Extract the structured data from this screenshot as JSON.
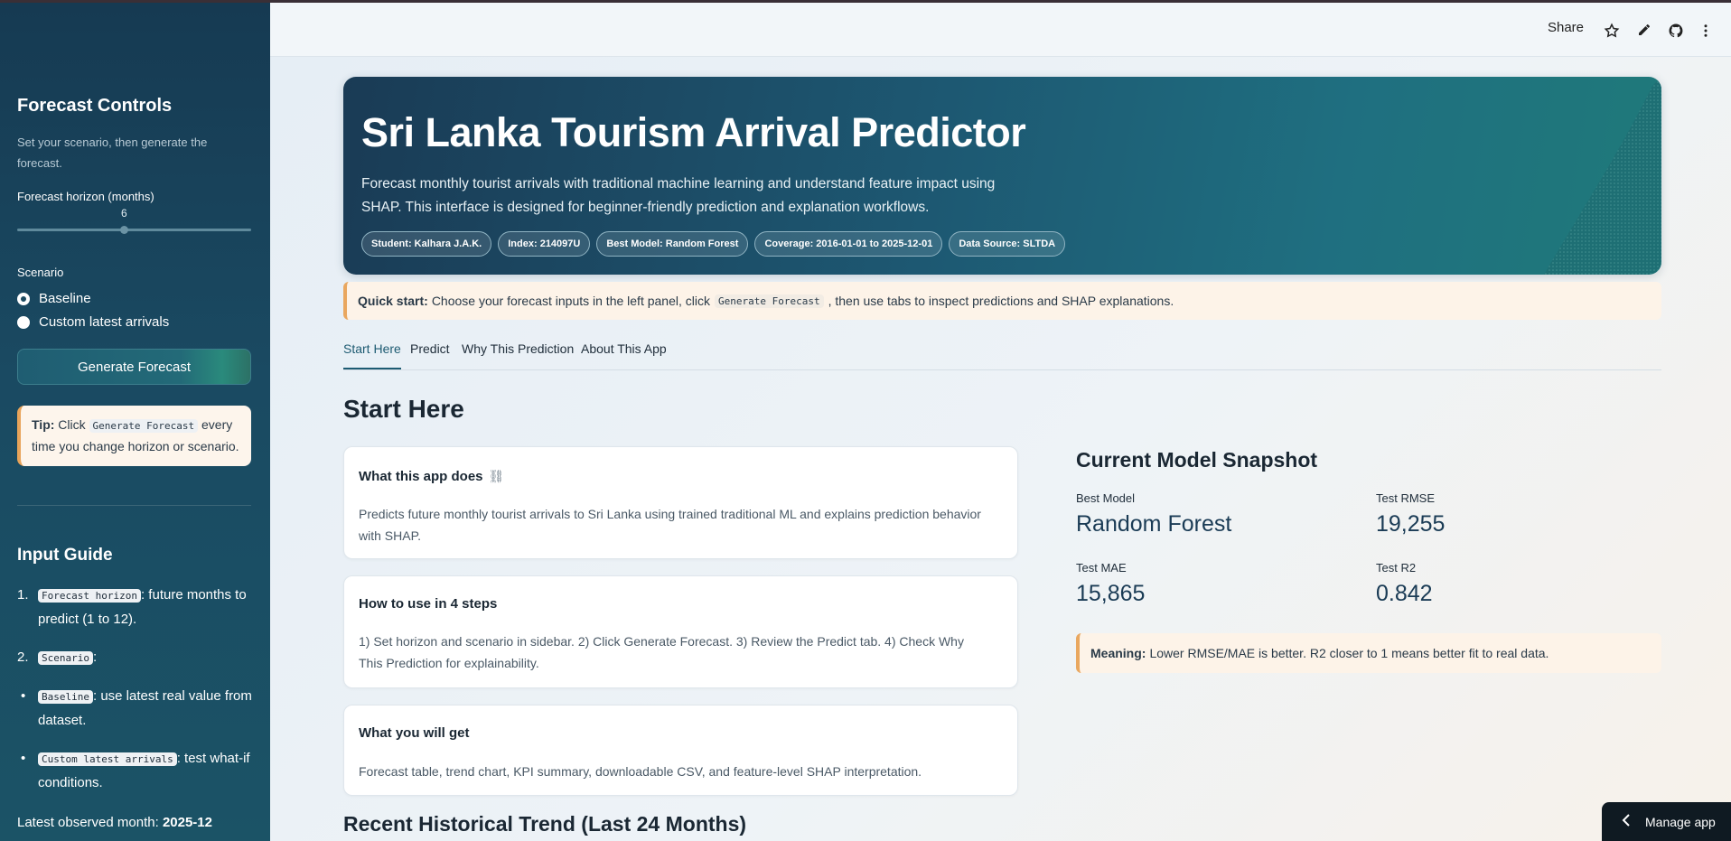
{
  "topbar": {
    "share_label": "Share"
  },
  "sidebar": {
    "title": "Forecast Controls",
    "subtitle": "Set your scenario, then generate the forecast.",
    "horizon_label": "Forecast horizon (months)",
    "horizon_value": "6",
    "horizon_fraction": 0.4545,
    "scenario_label": "Scenario",
    "scenario_options": [
      "Baseline",
      "Custom latest arrivals"
    ],
    "scenario_selected": "Baseline",
    "generate_button": "Generate Forecast",
    "tip": {
      "prefix": "Tip:",
      "pre": "Click",
      "code": "Generate Forecast",
      "post": "every time you change horizon or scenario."
    },
    "guide_title": "Input Guide",
    "guide": [
      {
        "marker": "1.",
        "code": "Forecast horizon",
        "text": ": future months to predict (1 to 12)."
      },
      {
        "marker": "2.",
        "code": "Scenario",
        "text": ":"
      },
      {
        "marker": "•",
        "code": "Baseline",
        "text": ": use latest real value from dataset."
      },
      {
        "marker": "•",
        "code": "Custom latest arrivals",
        "text": ": test what-if conditions."
      }
    ],
    "latest_label": "Latest observed month:",
    "latest_value": "2025-12"
  },
  "hero": {
    "title": "Sri Lanka Tourism Arrival Predictor",
    "description": "Forecast monthly tourist arrivals with traditional machine learning and understand feature impact using SHAP. This interface is designed for beginner-friendly prediction and explanation workflows.",
    "chips": [
      "Student: Kalhara J.A.K.",
      "Index: 214097U",
      "Best Model: Random Forest",
      "Coverage: 2016-01-01 to 2025-12-01",
      "Data Source: SLTDA"
    ]
  },
  "quick_start": {
    "label": "Quick start:",
    "pre": "Choose your forecast inputs in the left panel, click",
    "code": "Generate Forecast",
    "post": ", then use tabs to inspect predictions and SHAP explanations."
  },
  "tabs": [
    "Start Here",
    "Predict",
    "Why This Prediction",
    "About This App"
  ],
  "active_tab": "Start Here",
  "section_title": "Start Here",
  "cards": [
    {
      "title": "What this app does",
      "body": "Predicts future monthly tourist arrivals to Sri Lanka using trained traditional ML and explains prediction behavior with SHAP."
    },
    {
      "title": "How to use in 4 steps",
      "body": "1) Set horizon and scenario in sidebar. 2) Click Generate Forecast. 3) Review the Predict tab. 4) Check Why This Prediction for explainability."
    },
    {
      "title": "What you will get",
      "body": "Forecast table, trend chart, KPI summary, downloadable CSV, and feature-level SHAP interpretation."
    }
  ],
  "snapshot": {
    "title": "Current Model Snapshot",
    "metrics": [
      {
        "label": "Best Model",
        "value": "Random Forest"
      },
      {
        "label": "Test RMSE",
        "value": "19,255"
      },
      {
        "label": "Test MAE",
        "value": "15,865"
      },
      {
        "label": "Test R2",
        "value": "0.842"
      }
    ],
    "meaning_label": "Meaning:",
    "meaning_text": "Lower RMSE/MAE is better. R2 closer to 1 means better fit to real data."
  },
  "history_title": "Recent Historical Trend (Last 24 Months)",
  "manage_app": "Manage app"
}
